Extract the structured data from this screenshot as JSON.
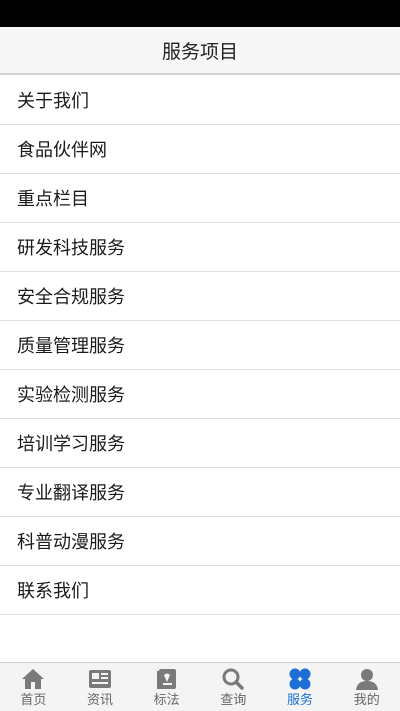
{
  "header": {
    "title": "服务项目"
  },
  "menu": {
    "items": [
      {
        "label": "关于我们"
      },
      {
        "label": "食品伙伴网"
      },
      {
        "label": "重点栏目"
      },
      {
        "label": "研发科技服务"
      },
      {
        "label": "安全合规服务"
      },
      {
        "label": "质量管理服务"
      },
      {
        "label": "实验检测服务"
      },
      {
        "label": "培训学习服务"
      },
      {
        "label": "专业翻译服务"
      },
      {
        "label": "科普动漫服务"
      },
      {
        "label": "联系我们"
      }
    ]
  },
  "tabbar": {
    "items": [
      {
        "label": "首页",
        "icon": "home-icon",
        "active": false
      },
      {
        "label": "资讯",
        "icon": "news-icon",
        "active": false
      },
      {
        "label": "标法",
        "icon": "standard-icon",
        "active": false
      },
      {
        "label": "查询",
        "icon": "search-icon",
        "active": false
      },
      {
        "label": "服务",
        "icon": "service-icon",
        "active": true
      },
      {
        "label": "我的",
        "icon": "user-icon",
        "active": false
      }
    ],
    "active_color": "#1d6fd6",
    "inactive_color": "#7a7a7a"
  }
}
